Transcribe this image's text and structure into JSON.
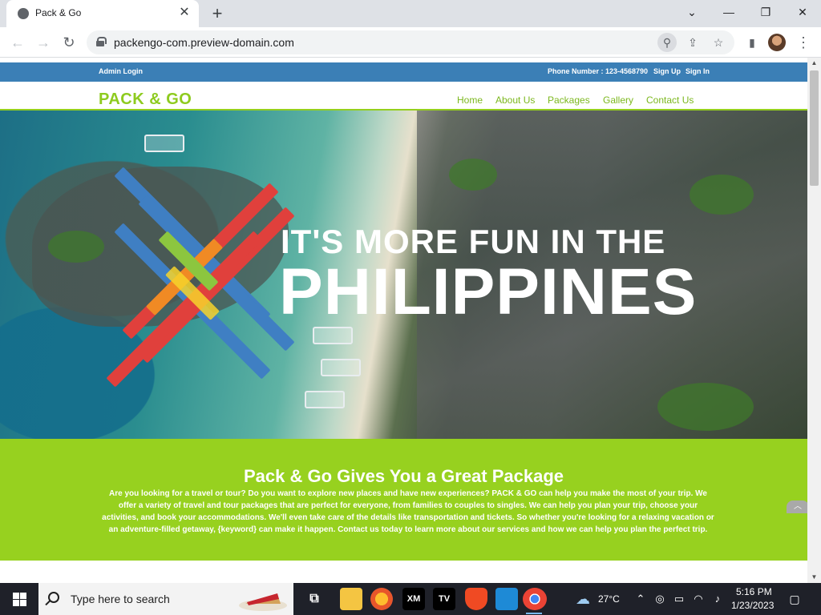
{
  "browser": {
    "tab_title": "Pack & Go",
    "tab_close": "✕",
    "new_tab": "+",
    "url": "packengo-com.preview-domain.com",
    "window_controls": {
      "minimize": "—",
      "restore": "❐",
      "close": "✕"
    },
    "nav_icons": {
      "back": "←",
      "forward": "→",
      "reload": "↻",
      "menu": "⋮"
    }
  },
  "site": {
    "topbar": {
      "admin_login": "Admin Login",
      "phone": "Phone Number : 123-4568790",
      "sign_up": "Sign Up",
      "sign_in": "Sign In"
    },
    "logo": "PACK & GO",
    "nav": [
      "Home",
      "About Us",
      "Packages",
      "Gallery",
      "Contact Us"
    ],
    "hero": {
      "line1": "IT'S MORE FUN IN THE",
      "line2": "PHILIPPINES"
    },
    "promo": {
      "heading": "Pack & Go Gives You a Great Package",
      "body": "Are you looking for a travel or tour? Do you want to explore new places and have new experiences? PACK & GO can help you make the most of your trip. We offer a variety of travel and tour packages that are perfect for everyone, from families to couples to singles. We can help you plan your trip, choose your activities, and book your accommodations. We'll even take care of the details like transportation and tickets. So whether you're looking for a relaxing vacation or an adventure-filled getaway, {keyword} can make it happen. Contact us today to learn more about our services and how we can help you plan the perfect trip."
    },
    "back_to_top": "︿"
  },
  "taskbar": {
    "search_placeholder": "Type here to search",
    "apps": [
      "XM",
      "TV"
    ],
    "weather": "27°C",
    "time": "5:16 PM",
    "date": "1/23/2023"
  },
  "colors": {
    "topbar_blue": "#3b7fb6",
    "brand_green": "#8ecb1f",
    "promo_green": "#97d11f"
  }
}
